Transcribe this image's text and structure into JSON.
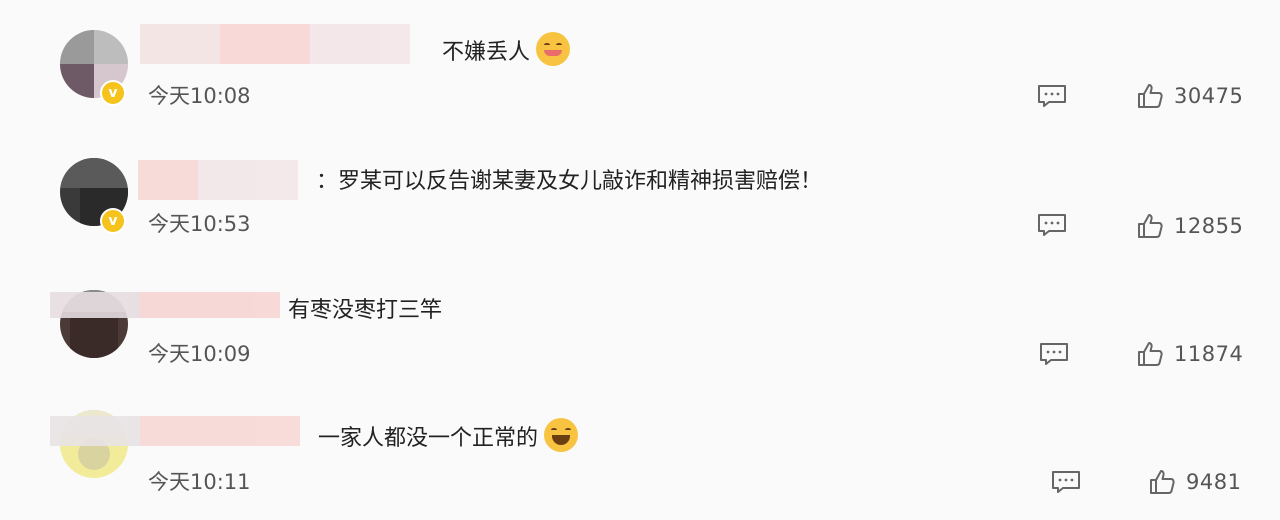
{
  "comments": [
    {
      "text": "不嫌丢人",
      "time": "今天10:08",
      "likes": "30475",
      "emoji": "yum-face"
    },
    {
      "text": "：罗某可以反告谢某妻及女儿敲诈和精神损害赔偿！",
      "time": "今天10:53",
      "likes": "12855"
    },
    {
      "text": "有枣没枣打三竿",
      "time": "今天10:09",
      "likes": "11874"
    },
    {
      "text": "一家人都没一个正常的",
      "time": "今天10:11",
      "likes": "9481",
      "emoji": "laugh-tears-face"
    }
  ],
  "icons": {
    "reply": "comment-icon",
    "like": "thumbs-up-icon",
    "verified": "verified-badge-icon"
  },
  "colors": {
    "badge": "#f6c21c",
    "text": "#222222",
    "meta": "#555555",
    "background": "#fafafa"
  }
}
